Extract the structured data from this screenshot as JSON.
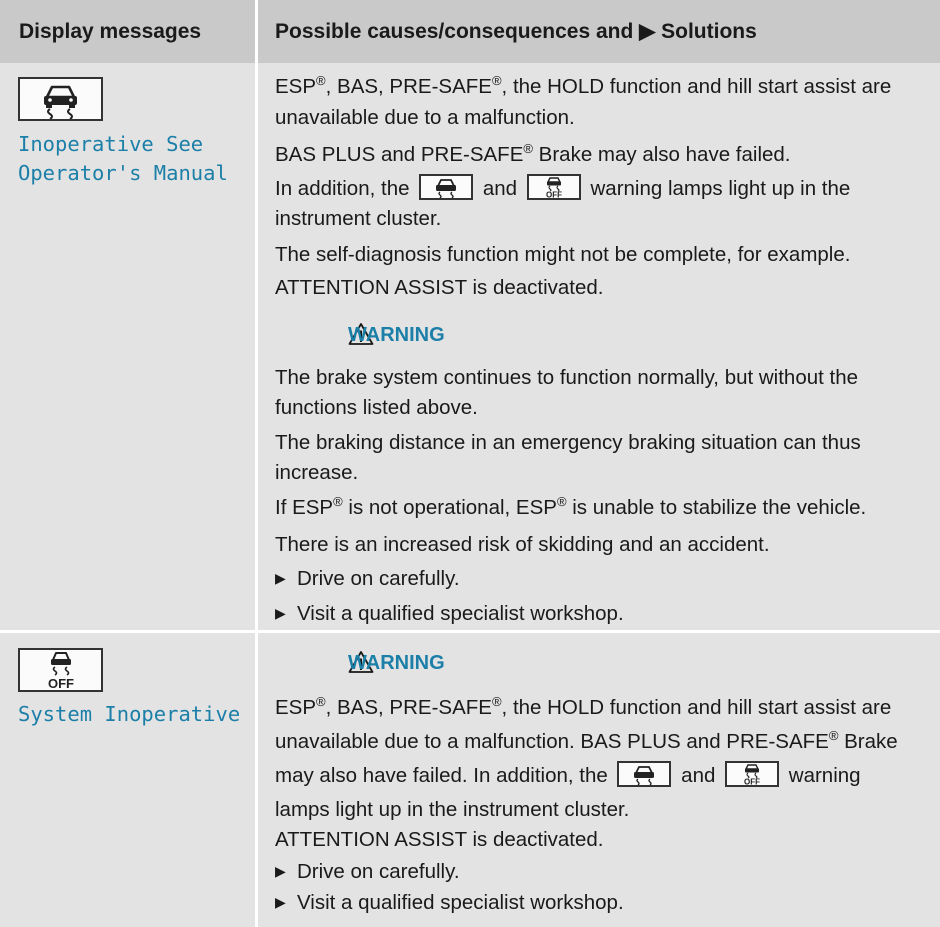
{
  "header": {
    "col1": "Display messages",
    "col2": "Possible causes/consequences and ▶ Solutions"
  },
  "icons": {
    "esp": "esp-skid-icon",
    "esp_off": "esp-off-icon",
    "warning": "warning-triangle-icon"
  },
  "colors": {
    "accent": "#1b7fa8",
    "header_bg": "#c9c9c9",
    "cell_bg": "#e3e3e3"
  },
  "row1": {
    "message": "Inoperative See\nOperator's Manual",
    "lines": [
      {
        "segs": [
          "ESP",
          "®",
          ", BAS, PRE-SAFE",
          "®",
          ", the HOLD function and hill start assist are"
        ]
      },
      {
        "text": "unavailable due to a malfunction."
      },
      {
        "segs": [
          "BAS PLUS and PRE-SAFE",
          "®",
          " Brake may also have failed."
        ]
      },
      {
        "parts": [
          "In addition, the",
          "and",
          "warning lamps light up in the"
        ]
      },
      {
        "text": "instrument cluster."
      },
      {
        "text": "The self-diagnosis function might not be complete, for example."
      },
      {
        "text": "ATTENTION ASSIST is deactivated."
      }
    ],
    "warning_label": "WARNING",
    "warning_lines": [
      {
        "text": "The brake system continues to function normally, but without the"
      },
      {
        "text": "functions listed above."
      },
      {
        "text": "The braking distance in an emergency braking situation can thus"
      },
      {
        "text": "increase."
      },
      {
        "segs": [
          "If ESP",
          "®",
          " is not operational, ESP",
          "®",
          " is unable to stabilize the vehicle."
        ]
      },
      {
        "text": "There is an increased risk of skidding and an accident."
      }
    ],
    "bullets": [
      "Drive on carefully.",
      "Visit a qualified specialist workshop."
    ]
  },
  "row2": {
    "message": "System Inoperative",
    "warning_label": "WARNING",
    "lines": [
      {
        "segs": [
          "ESP",
          "®",
          ", BAS, PRE-SAFE",
          "®",
          ", the HOLD function and hill start assist are"
        ]
      },
      {
        "segs": [
          "unavailable due to a malfunction. BAS PLUS and PRE-SAFE",
          "®",
          " Brake"
        ]
      },
      {
        "parts": [
          "may also have failed. In addition, the",
          "and",
          "warning"
        ]
      },
      {
        "text": "lamps light up in the instrument cluster."
      },
      {
        "text": "ATTENTION ASSIST is deactivated."
      }
    ],
    "bullets": [
      "Drive on carefully.",
      "Visit a qualified specialist workshop."
    ]
  }
}
